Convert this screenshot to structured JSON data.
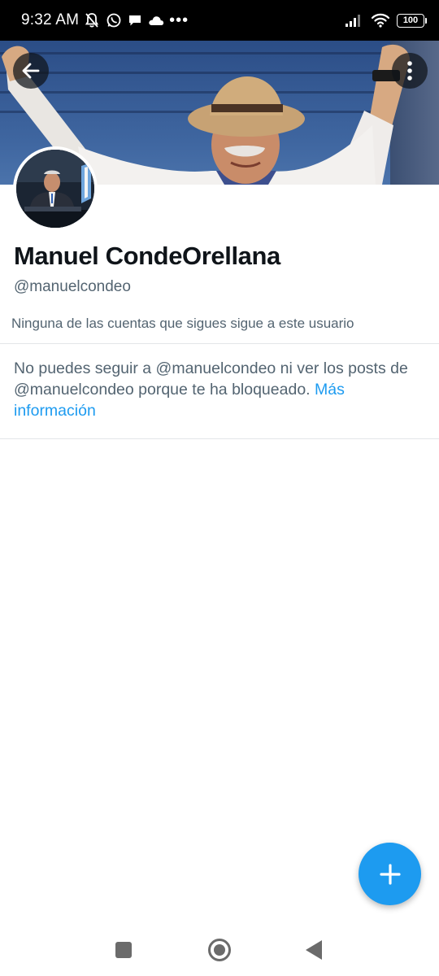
{
  "status_bar": {
    "time": "9:32 AM",
    "left_icons": [
      "muted-bell-icon",
      "whatsapp-icon",
      "chat-icon",
      "cloud-icon"
    ],
    "overflow": "•••",
    "battery": "100"
  },
  "header": {
    "back_icon": "arrow-left-icon",
    "more_icon": "more-vertical-icon"
  },
  "profile": {
    "display_name": "Manuel CondeOrellana",
    "handle": "@manuelcondeo",
    "follow_note": "Ninguna de las cuentas que sigues sigue a este usuario"
  },
  "blocked": {
    "message": "No puedes seguir a @manuelcondeo ni ver los posts de @manuelcondeo porque te ha bloqueado. ",
    "link": "Más información"
  },
  "fab": {
    "icon": "plus-icon"
  },
  "colors": {
    "accent": "#1d9bf0",
    "text_primary": "#0f1419",
    "text_secondary": "#536471",
    "divider": "#e3e6e8"
  },
  "nav_bar": {
    "icons": [
      "recents-square-icon",
      "home-circle-icon",
      "back-triangle-icon"
    ]
  }
}
